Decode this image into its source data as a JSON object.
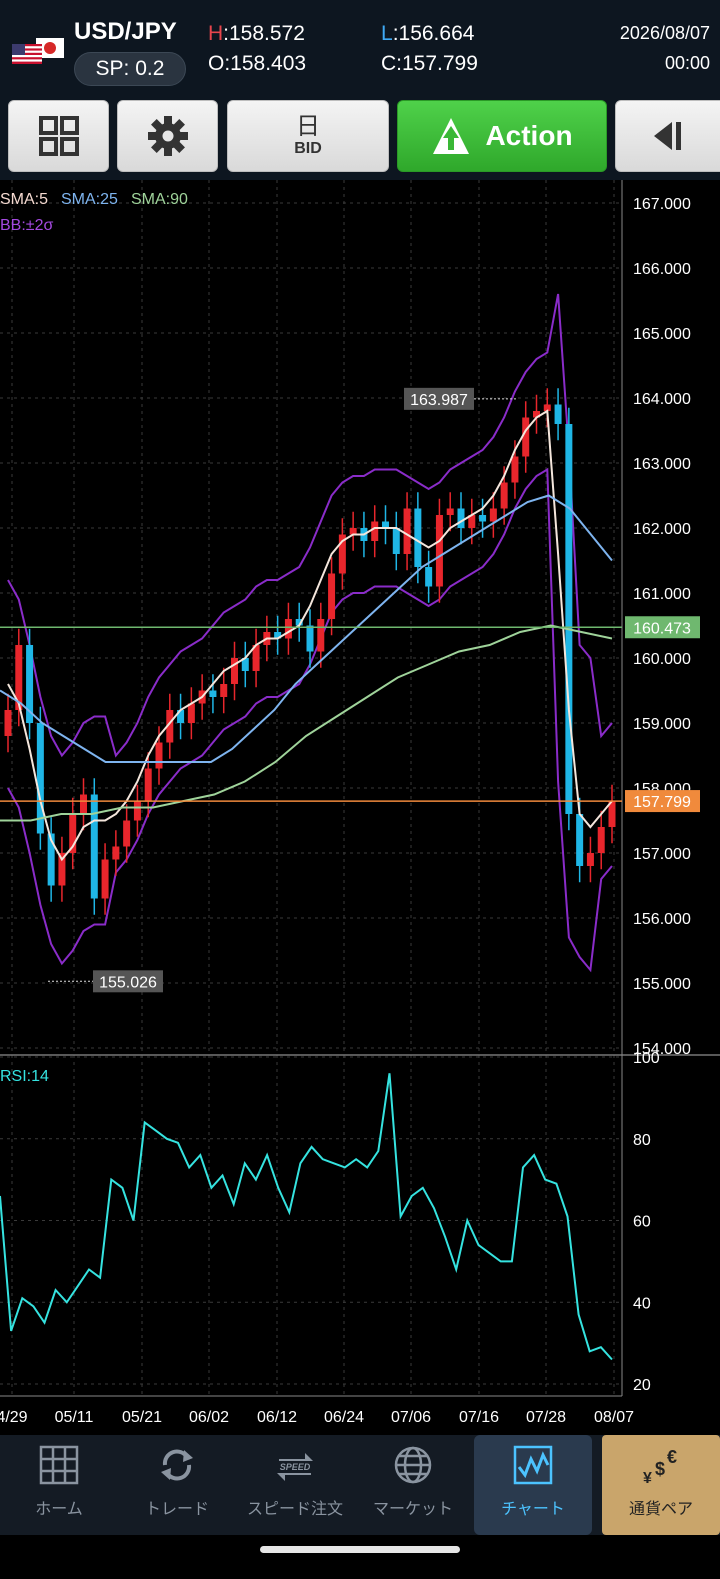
{
  "header": {
    "pair": "USD/JPY",
    "spread": "SP: 0.2",
    "high_label": "H",
    "high_value": ":158.572",
    "low_label": "L",
    "low_value": ":156.664",
    "open": "O:158.403",
    "close": "C:157.799",
    "date": "2026/08/07",
    "time": "00:00",
    "flags": [
      "us-flag-icon",
      "jp-flag-icon"
    ]
  },
  "toolbar": {
    "period_kanji": "日",
    "period_side": "BID",
    "action_label": "Action",
    "icons": [
      "grid-icon",
      "gear-icon",
      "action-icon",
      "collapse-left-icon"
    ]
  },
  "legend": {
    "sma5": "SMA:5",
    "sma25": "SMA:25",
    "sma90": "SMA:90",
    "bb": "BB:±2σ",
    "rsi": "RSI:14"
  },
  "price_axis": [
    "167.000",
    "166.000",
    "165.000",
    "164.000",
    "163.000",
    "162.000",
    "161.000",
    "160.000",
    "159.000",
    "158.000",
    "157.000",
    "156.000",
    "155.000",
    "154.000"
  ],
  "rsi_axis": [
    "100",
    "80",
    "60",
    "40",
    "20"
  ],
  "x_axis": [
    "4/29",
    "05/11",
    "05/21",
    "06/02",
    "06/12",
    "06/24",
    "07/06",
    "07/16",
    "07/28",
    "08/07"
  ],
  "markers": {
    "high": "163.987",
    "low": "155.026",
    "green_line": "160.473",
    "current": "157.799"
  },
  "colors": {
    "up": "#e8262c",
    "down": "#1fb6e6",
    "sma5": "#f4e6dc",
    "sma25": "#7eb4ef",
    "sma90": "#9fd39a",
    "bb": "#8a2cc9",
    "rsi": "#35e3e0",
    "green_line": "#6fb86f",
    "current_line": "#f08a3c"
  },
  "chart_data": {
    "type": "candlestick",
    "price_ylim": [
      154,
      167
    ],
    "rsi_ylim": [
      20,
      100
    ],
    "close_series": [
      159.2,
      160.2,
      159.0,
      157.3,
      156.5,
      157.0,
      157.6,
      157.9,
      156.3,
      156.9,
      157.1,
      157.5,
      157.8,
      158.3,
      158.7,
      159.2,
      159.0,
      159.3,
      159.5,
      159.4,
      159.6,
      160.0,
      159.8,
      160.2,
      160.4,
      160.3,
      160.6,
      160.5,
      160.1,
      160.6,
      161.3,
      161.9,
      162.0,
      161.8,
      162.1,
      162.0,
      161.6,
      162.3,
      161.4,
      161.1,
      162.2,
      162.3,
      162.0,
      162.2,
      162.1,
      162.3,
      162.7,
      163.1,
      163.7,
      163.8,
      163.9,
      163.6,
      157.6,
      156.8,
      157.0,
      157.4,
      157.8
    ],
    "sma5": [
      159.6,
      159.3,
      158.6,
      157.8,
      157.2,
      156.9,
      157.1,
      157.4,
      157.5,
      157.5,
      157.6,
      157.8,
      158.1,
      158.5,
      158.8,
      159.0,
      159.2,
      159.3,
      159.4,
      159.6,
      159.8,
      159.9,
      160.0,
      160.2,
      160.3,
      160.3,
      160.4,
      160.5,
      160.8,
      161.2,
      161.6,
      161.8,
      161.9,
      161.9,
      162.0,
      162.0,
      162.0,
      161.9,
      161.8,
      161.7,
      161.8,
      162.0,
      162.1,
      162.2,
      162.3,
      162.5,
      162.8,
      163.2,
      163.5,
      163.7,
      163.8,
      161.6,
      159.2,
      157.6,
      157.4,
      157.6,
      157.8
    ],
    "sma25": [
      159.5,
      159.3,
      159.0,
      158.8,
      158.6,
      158.4,
      158.4,
      158.4,
      158.4,
      158.4,
      158.4,
      158.6,
      158.9,
      159.2,
      159.6,
      159.9,
      160.2,
      160.5,
      160.8,
      161.1,
      161.4,
      161.6,
      161.8,
      162.0,
      162.2,
      162.4,
      162.5,
      162.3,
      161.9,
      161.5
    ],
    "sma90": [
      157.5,
      157.5,
      157.6,
      157.6,
      157.7,
      157.7,
      157.8,
      157.9,
      158.1,
      158.4,
      158.8,
      159.1,
      159.4,
      159.7,
      159.9,
      160.1,
      160.2,
      160.4,
      160.5,
      160.4,
      160.3
    ],
    "rsi": [
      66,
      33,
      41,
      39,
      35,
      43,
      40,
      44,
      48,
      46,
      70,
      68,
      60,
      84,
      82,
      80,
      79,
      73,
      76,
      68,
      71,
      64,
      74,
      70,
      76,
      68,
      62,
      74,
      78,
      75,
      74,
      73,
      75,
      73,
      77,
      96,
      61,
      66,
      68,
      63,
      56,
      48,
      60,
      54,
      52,
      50,
      50,
      73,
      76,
      70,
      69,
      61,
      37,
      28,
      29,
      26
    ]
  }
}
